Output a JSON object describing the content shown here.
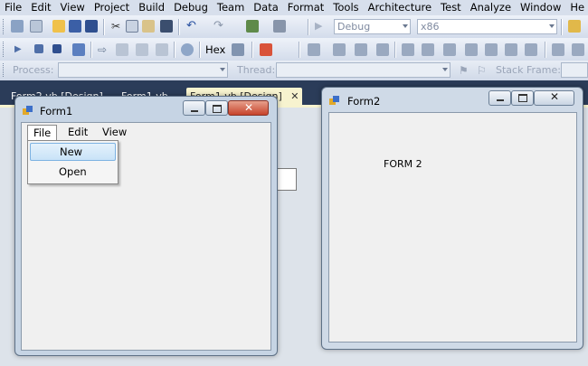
{
  "menubar": {
    "items": [
      "File",
      "Edit",
      "View",
      "Project",
      "Build",
      "Debug",
      "Team",
      "Data",
      "Format",
      "Tools",
      "Architecture",
      "Test",
      "Analyze",
      "Window",
      "He"
    ]
  },
  "toolbar1": {
    "config_combo": "Debug",
    "platform_combo": "x86"
  },
  "toolbar2": {
    "hex_label": "Hex"
  },
  "debug_location": {
    "process_label": "Process:",
    "thread_label": "Thread:",
    "stack_frame_label": "Stack Frame:"
  },
  "tabs": [
    {
      "label": "Form2.vb [Design]"
    },
    {
      "label": "Form1.vb"
    },
    {
      "label": "Form1.vb [Design]"
    }
  ],
  "form1": {
    "title": "Form1",
    "menu": [
      "File",
      "Edit",
      "View"
    ],
    "dropdown": [
      "New",
      "Open"
    ]
  },
  "form2": {
    "title": "Form2",
    "label": "FORM 2"
  },
  "colors": {
    "ide_background": "#2b3c59",
    "active_tab": "#f7f3cf",
    "window_frame": "#c6d4e4",
    "client_area": "#f0f0f0",
    "close_button": "#c7432b"
  }
}
